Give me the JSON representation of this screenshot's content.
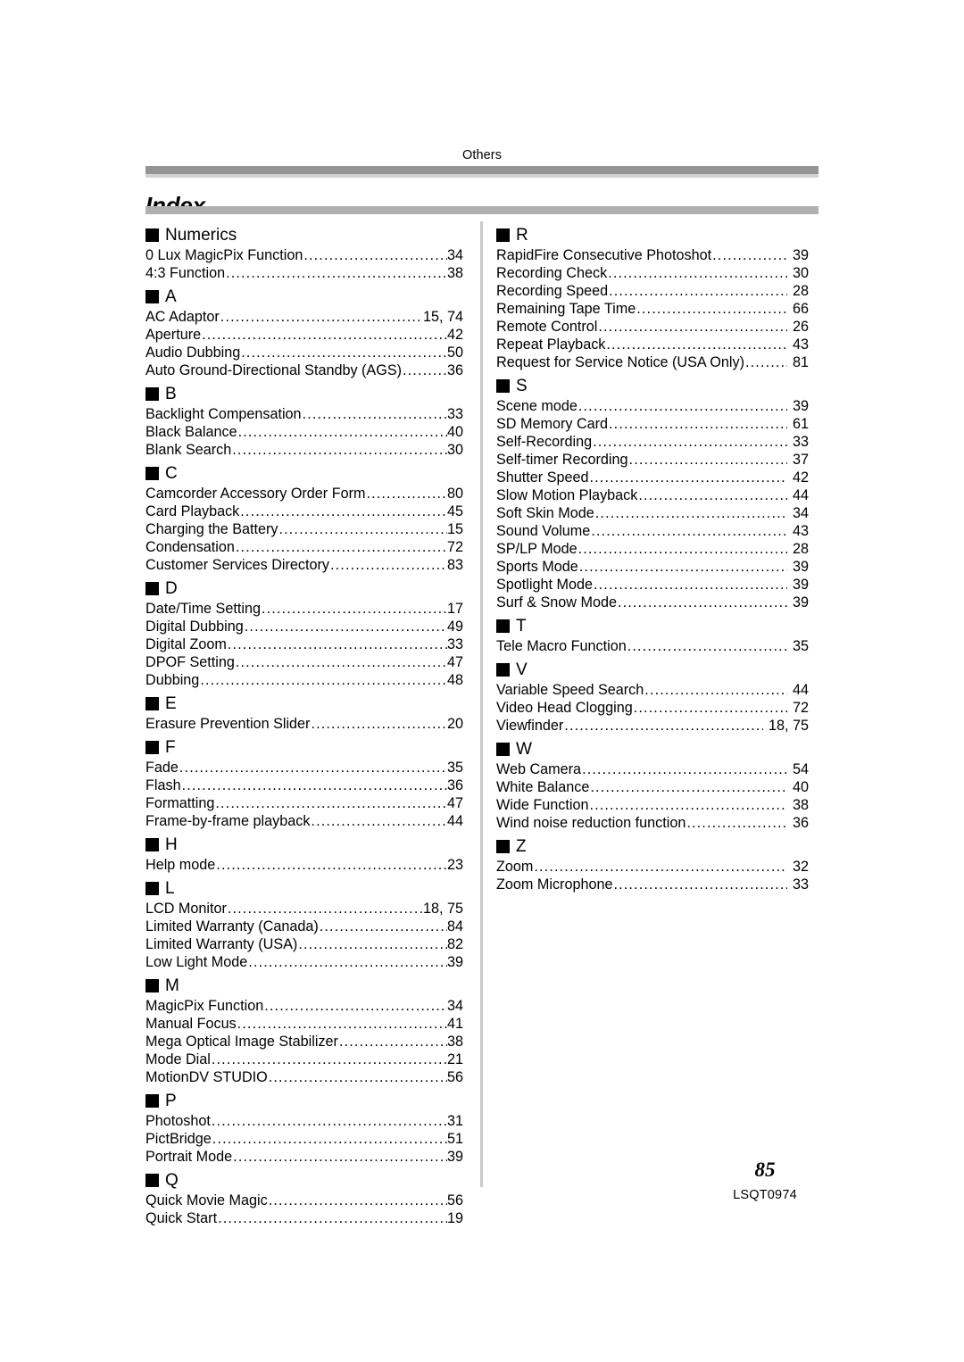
{
  "header": {
    "running_head": "Others",
    "title": "Index"
  },
  "footer": {
    "page_number": "85",
    "document_code": "LSQT0974"
  },
  "columns": [
    {
      "name": "left",
      "sections": [
        {
          "letter": "Numerics",
          "entries": [
            {
              "label": "0 Lux MagicPix Function",
              "page": "34"
            },
            {
              "label": "4:3 Function",
              "page": "38"
            }
          ]
        },
        {
          "letter": "A",
          "entries": [
            {
              "label": "AC Adaptor",
              "page": "15, 74"
            },
            {
              "label": "Aperture",
              "page": "42"
            },
            {
              "label": "Audio Dubbing",
              "page": "50"
            },
            {
              "label": "Auto Ground-Directional Standby (AGS)",
              "page": "36"
            }
          ]
        },
        {
          "letter": "B",
          "entries": [
            {
              "label": "Backlight Compensation",
              "page": "33"
            },
            {
              "label": "Black Balance",
              "page": "40"
            },
            {
              "label": "Blank Search",
              "page": "30"
            }
          ]
        },
        {
          "letter": "C",
          "entries": [
            {
              "label": "Camcorder Accessory Order Form",
              "page": "80"
            },
            {
              "label": "Card Playback",
              "page": "45"
            },
            {
              "label": "Charging the Battery",
              "page": "15"
            },
            {
              "label": "Condensation",
              "page": "72"
            },
            {
              "label": "Customer Services Directory",
              "page": "83"
            }
          ]
        },
        {
          "letter": "D",
          "entries": [
            {
              "label": "Date/Time Setting",
              "page": "17"
            },
            {
              "label": "Digital Dubbing",
              "page": "49"
            },
            {
              "label": "Digital Zoom",
              "page": "33"
            },
            {
              "label": "DPOF Setting",
              "page": "47"
            },
            {
              "label": "Dubbing",
              "page": "48"
            }
          ]
        },
        {
          "letter": "E",
          "entries": [
            {
              "label": "Erasure Prevention Slider",
              "page": "20"
            }
          ]
        },
        {
          "letter": "F",
          "entries": [
            {
              "label": "Fade",
              "page": "35"
            },
            {
              "label": "Flash",
              "page": "36"
            },
            {
              "label": "Formatting",
              "page": "47"
            },
            {
              "label": "Frame-by-frame playback",
              "page": "44"
            }
          ]
        },
        {
          "letter": "H",
          "entries": [
            {
              "label": "Help mode",
              "page": "23"
            }
          ]
        },
        {
          "letter": "L",
          "entries": [
            {
              "label": "LCD Monitor",
              "page": "18, 75"
            },
            {
              "label": "Limited Warranty (Canada)",
              "page": "84"
            },
            {
              "label": "Limited Warranty (USA)",
              "page": "82"
            },
            {
              "label": "Low Light Mode",
              "page": "39"
            }
          ]
        },
        {
          "letter": "M",
          "entries": [
            {
              "label": "MagicPix Function",
              "page": "34"
            },
            {
              "label": "Manual Focus",
              "page": "41"
            },
            {
              "label": "Mega Optical Image Stabilizer",
              "page": "38"
            },
            {
              "label": "Mode Dial",
              "page": "21"
            },
            {
              "label": "MotionDV STUDIO",
              "page": "56"
            }
          ]
        },
        {
          "letter": "P",
          "entries": [
            {
              "label": "Photoshot",
              "page": "31"
            },
            {
              "label": "PictBridge",
              "page": "51"
            },
            {
              "label": "Portrait Mode",
              "page": "39"
            }
          ]
        },
        {
          "letter": "Q",
          "entries": [
            {
              "label": "Quick Movie Magic",
              "page": "56"
            },
            {
              "label": "Quick Start",
              "page": "19"
            }
          ]
        }
      ]
    },
    {
      "name": "right",
      "sections": [
        {
          "letter": "R",
          "entries": [
            {
              "label": "RapidFire Consecutive Photoshot",
              "page": "39"
            },
            {
              "label": "Recording Check",
              "page": "30"
            },
            {
              "label": "Recording Speed",
              "page": "28"
            },
            {
              "label": "Remaining Tape Time",
              "page": "66"
            },
            {
              "label": "Remote Control",
              "page": "26"
            },
            {
              "label": "Repeat Playback",
              "page": "43"
            },
            {
              "label": "Request for Service Notice (USA Only)",
              "page": "81"
            }
          ]
        },
        {
          "letter": "S",
          "entries": [
            {
              "label": "Scene mode",
              "page": "39"
            },
            {
              "label": "SD Memory Card",
              "page": "61"
            },
            {
              "label": "Self-Recording",
              "page": "33"
            },
            {
              "label": "Self-timer Recording",
              "page": "37"
            },
            {
              "label": "Shutter Speed",
              "page": "42"
            },
            {
              "label": "Slow Motion Playback",
              "page": "44"
            },
            {
              "label": "Soft Skin Mode",
              "page": "34"
            },
            {
              "label": "Sound Volume",
              "page": "43"
            },
            {
              "label": "SP/LP Mode",
              "page": "28"
            },
            {
              "label": "Sports Mode",
              "page": "39"
            },
            {
              "label": "Spotlight Mode",
              "page": "39"
            },
            {
              "label": "Surf & Snow Mode",
              "page": "39"
            }
          ]
        },
        {
          "letter": "T",
          "entries": [
            {
              "label": "Tele Macro Function",
              "page": "35"
            }
          ]
        },
        {
          "letter": "V",
          "entries": [
            {
              "label": "Variable Speed Search",
              "page": "44"
            },
            {
              "label": "Video Head Clogging",
              "page": "72"
            },
            {
              "label": "Viewfinder",
              "page": "18, 75"
            }
          ]
        },
        {
          "letter": "W",
          "entries": [
            {
              "label": "Web Camera",
              "page": "54"
            },
            {
              "label": "White Balance",
              "page": "40"
            },
            {
              "label": "Wide Function",
              "page": "38"
            },
            {
              "label": "Wind noise reduction function",
              "page": "36"
            }
          ]
        },
        {
          "letter": "Z",
          "entries": [
            {
              "label": "Zoom",
              "page": "32"
            },
            {
              "label": "Zoom Microphone",
              "page": "33"
            }
          ]
        }
      ]
    }
  ]
}
